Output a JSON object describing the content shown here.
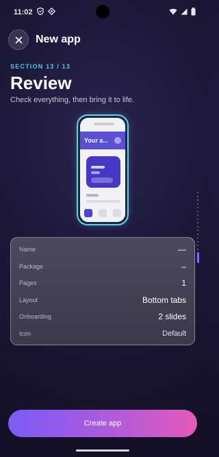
{
  "status_bar": {
    "time": "11:02"
  },
  "header": {
    "title": "New app"
  },
  "section": {
    "label": "SECTION 13 / 13",
    "title": "Review",
    "subtitle": "Check everything, then bring it to life."
  },
  "preview": {
    "app_title": "Your a..."
  },
  "summary": {
    "rows": [
      {
        "label": "Name",
        "value": "—"
      },
      {
        "label": "Package",
        "value": "–"
      },
      {
        "label": "Pages",
        "value": "1"
      },
      {
        "label": "Layout",
        "value": "Bottom tabs"
      },
      {
        "label": "Onboarding",
        "value": "2 slides"
      },
      {
        "label": "Icon",
        "value": "Default"
      }
    ]
  },
  "actions": {
    "create_label": "Create app"
  },
  "colors": {
    "accent": "#4fc9e8",
    "preview_appbar": "#5b4fd6",
    "button_start": "#7a5cf7",
    "button_end": "#e55ab8"
  }
}
